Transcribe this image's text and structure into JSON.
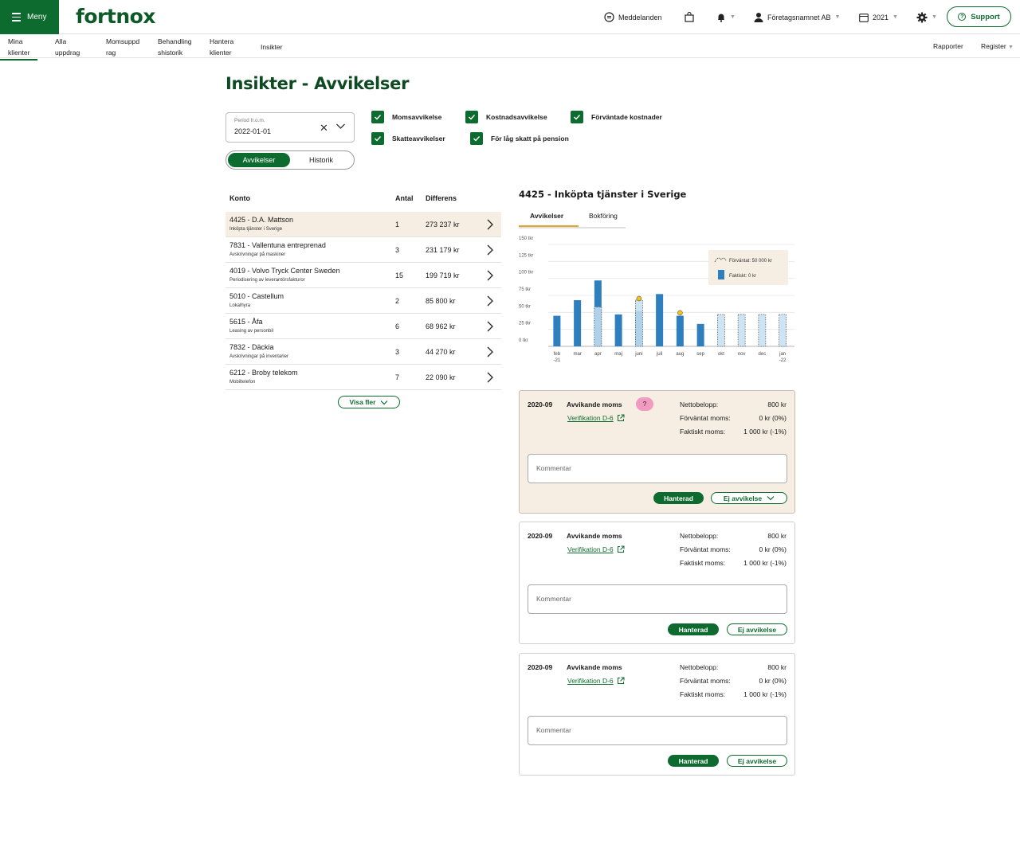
{
  "topbar": {
    "menu_label": "Meny",
    "logo_text": "fortnox",
    "messages_label": "Meddelanden",
    "company_label": "Företagsnamnet AB",
    "year_label": "2021",
    "support_label": "Support"
  },
  "subnav": {
    "items": [
      {
        "line1": "Mina",
        "line2": "klienter"
      },
      {
        "line1": "Alla",
        "line2": "uppdrag"
      },
      {
        "line1": "Momsuppd",
        "line2": "rag"
      },
      {
        "line1": "Behandling",
        "line2": "shistorik"
      },
      {
        "line1": "Hantera",
        "line2": "klienter"
      },
      {
        "line1": "Insikter",
        "line2": ""
      }
    ],
    "right": [
      "Rapporter",
      "Register"
    ]
  },
  "page": {
    "title": "Insikter - Avvikelser",
    "period_label": "Period fr.o.m.",
    "period_value": "2022-01-01",
    "toggle": [
      "Avvikelser",
      "Historik"
    ],
    "checkboxes": [
      "Momsavvikelse",
      "Kostnadsavvikelse",
      "Förväntade kostnader",
      "Skatteavvikelser",
      "För låg skatt på pension"
    ]
  },
  "table": {
    "headers": [
      "Konto",
      "Antal",
      "Differens"
    ],
    "rows": [
      {
        "name": "4425 - D.A. Mattson",
        "sub": "Inköpta tjänster i Sverige",
        "count": "1",
        "diff": "273 237 kr"
      },
      {
        "name": "7831 - Vallentuna entreprenad",
        "sub": "Avskrivningar på maskiner",
        "count": "3",
        "diff": "231 179 kr"
      },
      {
        "name": "4019 - Volvo Tryck Center Sweden",
        "sub": "Periodisering av leverantörsfakturor",
        "count": "15",
        "diff": "199 719 kr"
      },
      {
        "name": "5010 - Castellum",
        "sub": "Lokalhyra",
        "count": "2",
        "diff": "85 800 kr"
      },
      {
        "name": "5615 - Åfa",
        "sub": "Leasing av personbil",
        "count": "6",
        "diff": "68 962 kr"
      },
      {
        "name": "7832 - Däckia",
        "sub": "Avskrivningar på inventarier",
        "count": "3",
        "diff": "44 270 kr"
      },
      {
        "name": "6212 - Broby telekom",
        "sub": "Mobiltelefon",
        "count": "7",
        "diff": "22 090 kr"
      }
    ],
    "show_more": "Visa fler"
  },
  "detail": {
    "title": "4425 - Inköpta tjänster i Sverige",
    "tabs": [
      "Avvikelser",
      "Bokföring"
    ]
  },
  "chart_data": {
    "type": "bar",
    "categories": [
      "feb -21",
      "mar",
      "apr",
      "maj",
      "juni",
      "juli",
      "aug",
      "sep",
      "okt",
      "nov",
      "dec",
      "jan -22"
    ],
    "yticks": [
      "150 tkr",
      "125 tkr",
      "100 tkr",
      "75 tkr",
      "50 tkr",
      "25 tkr",
      "0 tkr"
    ],
    "ylim": [
      0,
      150
    ],
    "series": [
      {
        "name": "Faktiskt: 0 kr",
        "values": [
          45,
          68,
          97,
          47,
          52,
          77,
          45,
          33,
          0,
          0,
          0,
          0
        ]
      },
      {
        "name": "Förväntat: 50 000 kr",
        "values": [
          null,
          null,
          58,
          null,
          68,
          null,
          null,
          null,
          47,
          47,
          47,
          47
        ]
      }
    ],
    "legend": [
      "Förväntat: 50 000 kr",
      "Faktiskt: 0 kr"
    ],
    "legend_position": "top-right",
    "colors": {
      "actual": "#2f7fbf",
      "expected": "#c6dff0"
    }
  },
  "cards": [
    {
      "period": "2020-09",
      "type": "Avvikande moms",
      "badge": "?",
      "verification": "Verifikation D-6",
      "k1": "Nettobelopp:",
      "v1": "800 kr",
      "k2": "Förväntat moms:",
      "v2": "0 kr (0%)",
      "k3": "Faktiskt moms:",
      "v3": "1 000 kr (-1%)",
      "comment_placeholder": "Kommentar",
      "handled": "Hanterad",
      "not_deviation": "Ej avvikelse"
    },
    {
      "period": "2020-09",
      "type": "Avvikande moms",
      "badge": "",
      "verification": "Verifikation D-6",
      "k1": "Nettobelopp:",
      "v1": "800 kr",
      "k2": "Förväntat moms:",
      "v2": "0 kr (0%)",
      "k3": "Faktiskt moms:",
      "v3": "1 000 kr (-1%)",
      "comment_placeholder": "Kommentar",
      "handled": "Hanterad",
      "not_deviation": "Ej avvikelse"
    },
    {
      "period": "2020-09",
      "type": "Avvikande moms",
      "badge": "",
      "verification": "Verifikation D-6",
      "k1": "Nettobelopp:",
      "v1": "800 kr",
      "k2": "Förväntat moms:",
      "v2": "0 kr (0%)",
      "k3": "Faktiskt moms:",
      "v3": "1 000 kr (-1%)",
      "comment_placeholder": "Kommentar",
      "handled": "Hanterad",
      "not_deviation": "Ej avvikelse"
    }
  ]
}
